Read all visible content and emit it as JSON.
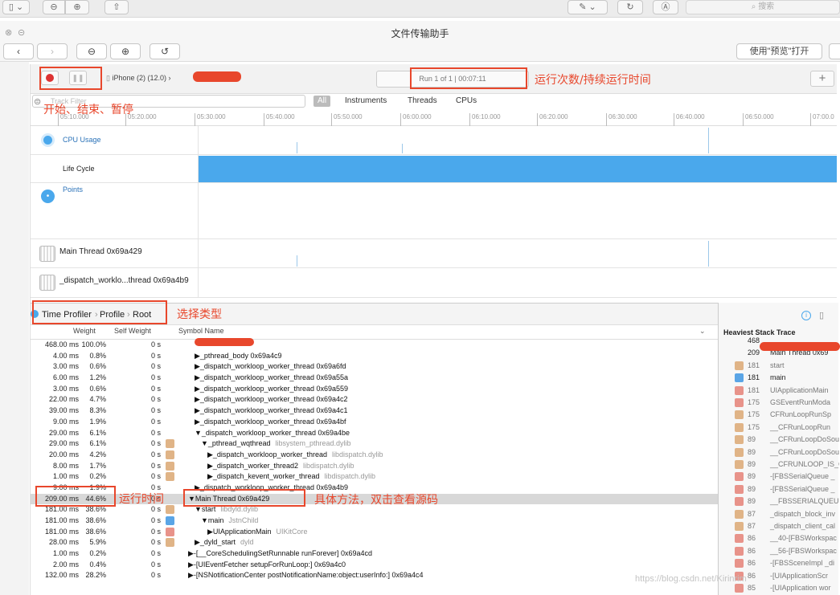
{
  "system_toolbar": {
    "search_placeholder": "搜索"
  },
  "window": {
    "title": "文件传输助手",
    "open_with_preview": "使用\"预览\"打开"
  },
  "instruments": {
    "device": "iPhone (2) (12.0)",
    "status": "Run 1 of 1  |  00:07:11",
    "filter_placeholder": "Track Filter",
    "filters": [
      "All",
      "Instruments",
      "Threads",
      "CPUs"
    ],
    "timeline_ticks": [
      "05:10.000",
      "05:20.000",
      "05:30.000",
      "05:40.000",
      "05:50.000",
      "06:00.000",
      "06:10.000",
      "06:20.000",
      "06:30.000",
      "06:40.000",
      "06:50.000",
      "07:00.0"
    ],
    "tracks": [
      {
        "name": "CPU Usage",
        "icon": "cpu-usage-icon"
      },
      {
        "name": "Life Cycle",
        "icon": ""
      },
      {
        "name": "Points",
        "icon": "points-icon"
      },
      {
        "name": "Main Thread  0x69a429",
        "icon": "thread-icon"
      },
      {
        "name": "_dispatch_worklo...thread  0x69a4b9",
        "icon": "thread-icon"
      }
    ],
    "breadcrumb": [
      "Time Profiler",
      "Profile",
      "Root"
    ],
    "columns": {
      "weight": "Weight",
      "self_weight": "Self Weight",
      "symbol": "Symbol Name"
    },
    "rows": [
      {
        "w": "468.00 ms",
        "p": "100.0%",
        "s": "0 s",
        "sym": "",
        "lib": "",
        "indent": 0,
        "icon": ""
      },
      {
        "w": "4.00 ms",
        "p": "0.8%",
        "s": "0 s",
        "sym": "▶_pthread_body  0x69a4c9",
        "lib": "",
        "indent": 1,
        "icon": ""
      },
      {
        "w": "3.00 ms",
        "p": "0.6%",
        "s": "0 s",
        "sym": "▶_dispatch_workloop_worker_thread  0x69a6fd",
        "lib": "",
        "indent": 1,
        "icon": ""
      },
      {
        "w": "6.00 ms",
        "p": "1.2%",
        "s": "0 s",
        "sym": "▶_dispatch_workloop_worker_thread  0x69a55a",
        "lib": "",
        "indent": 1,
        "icon": ""
      },
      {
        "w": "3.00 ms",
        "p": "0.6%",
        "s": "0 s",
        "sym": "▶_dispatch_workloop_worker_thread  0x69a559",
        "lib": "",
        "indent": 1,
        "icon": ""
      },
      {
        "w": "22.00 ms",
        "p": "4.7%",
        "s": "0 s",
        "sym": "▶_dispatch_workloop_worker_thread  0x69a4c2",
        "lib": "",
        "indent": 1,
        "icon": ""
      },
      {
        "w": "39.00 ms",
        "p": "8.3%",
        "s": "0 s",
        "sym": "▶_dispatch_workloop_worker_thread  0x69a4c1",
        "lib": "",
        "indent": 1,
        "icon": ""
      },
      {
        "w": "9.00 ms",
        "p": "1.9%",
        "s": "0 s",
        "sym": "▶_dispatch_workloop_worker_thread  0x69a4bf",
        "lib": "",
        "indent": 1,
        "icon": ""
      },
      {
        "w": "29.00 ms",
        "p": "6.1%",
        "s": "0 s",
        "sym": "▼_dispatch_workloop_worker_thread  0x69a4be",
        "lib": "",
        "indent": 1,
        "icon": ""
      },
      {
        "w": "29.00 ms",
        "p": "6.1%",
        "s": "0 s",
        "sym": "▼_pthread_wqthread",
        "lib": "libsystem_pthread.dylib",
        "indent": 2,
        "icon": "lib"
      },
      {
        "w": "20.00 ms",
        "p": "4.2%",
        "s": "0 s",
        "sym": "▶_dispatch_workloop_worker_thread",
        "lib": "libdispatch.dylib",
        "indent": 3,
        "icon": "lib"
      },
      {
        "w": "8.00 ms",
        "p": "1.7%",
        "s": "0 s",
        "sym": "▶_dispatch_worker_thread2",
        "lib": "libdispatch.dylib",
        "indent": 3,
        "icon": "lib"
      },
      {
        "w": "1.00 ms",
        "p": "0.2%",
        "s": "0 s",
        "sym": "▶_dispatch_kevent_worker_thread",
        "lib": "libdispatch.dylib",
        "indent": 3,
        "icon": "lib"
      },
      {
        "w": "9.00 ms",
        "p": "1.9%",
        "s": "0 s",
        "sym": "▶_dispatch_workloop_worker_thread  0x69a4b9",
        "lib": "",
        "indent": 1,
        "icon": ""
      },
      {
        "w": "209.00 ms",
        "p": "44.6%",
        "s": "0 s",
        "sym": "▼Main Thread  0x69a429",
        "lib": "",
        "indent": 0,
        "icon": "",
        "hl": true
      },
      {
        "w": "181.00 ms",
        "p": "38.6%",
        "s": "0 s",
        "sym": "▼start",
        "lib": "libdyld.dylib",
        "indent": 1,
        "icon": "lib"
      },
      {
        "w": "181.00 ms",
        "p": "38.6%",
        "s": "0 s",
        "sym": "▼main",
        "lib": "JstnChild",
        "indent": 2,
        "icon": "user"
      },
      {
        "w": "181.00 ms",
        "p": "38.6%",
        "s": "0 s",
        "sym": "▶UIApplicationMain",
        "lib": "UIKitCore",
        "indent": 3,
        "icon": "sys"
      },
      {
        "w": "28.00 ms",
        "p": "5.9%",
        "s": "0 s",
        "sym": "▶_dyld_start",
        "lib": "dyld",
        "indent": 1,
        "icon": "lib"
      },
      {
        "w": "1.00 ms",
        "p": "0.2%",
        "s": "0 s",
        "sym": "▶-[__CoreSchedulingSetRunnable runForever]  0x69a4cd",
        "lib": "",
        "indent": 0,
        "icon": ""
      },
      {
        "w": "2.00 ms",
        "p": "0.4%",
        "s": "0 s",
        "sym": "▶-[UIEventFetcher setupForRunLoop:]  0x69a4c0",
        "lib": "",
        "indent": 0,
        "icon": ""
      },
      {
        "w": "132.00 ms",
        "p": "28.2%",
        "s": "0 s",
        "sym": "▶-[NSNotificationCenter postNotificationName:object:userInfo:]  0x69a4c4",
        "lib": "",
        "indent": 0,
        "icon": ""
      }
    ],
    "heaviest": {
      "title": "Heaviest Stack Trace",
      "rows": [
        {
          "n": "468",
          "l": "",
          "icon": "",
          "dark": true
        },
        {
          "n": "209",
          "l": "Main Thread  0x69",
          "icon": "",
          "dark": true
        },
        {
          "n": "181",
          "l": "start",
          "icon": "lib"
        },
        {
          "n": "181",
          "l": "main",
          "icon": "user",
          "dark": true
        },
        {
          "n": "181",
          "l": "UIApplicationMain",
          "icon": "sys"
        },
        {
          "n": "175",
          "l": "GSEventRunModa",
          "icon": "sys"
        },
        {
          "n": "175",
          "l": "CFRunLoopRunSp",
          "icon": "lib"
        },
        {
          "n": "175",
          "l": "__CFRunLoopRun",
          "icon": "lib"
        },
        {
          "n": "89",
          "l": "__CFRunLoopDoSou",
          "icon": "lib"
        },
        {
          "n": "89",
          "l": "__CFRunLoopDoSou",
          "icon": "lib"
        },
        {
          "n": "89",
          "l": "__CFRUNLOOP_IS_C",
          "icon": "lib"
        },
        {
          "n": "89",
          "l": "-[FBSSerialQueue _",
          "icon": "sys"
        },
        {
          "n": "89",
          "l": "-[FBSSerialQueue _",
          "icon": "sys"
        },
        {
          "n": "89",
          "l": "__FBSSERIALQUEUI",
          "icon": "sys"
        },
        {
          "n": "87",
          "l": "_dispatch_block_inv",
          "icon": "lib"
        },
        {
          "n": "87",
          "l": "_dispatch_client_cal",
          "icon": "lib"
        },
        {
          "n": "86",
          "l": "__40-[FBSWorkspac",
          "icon": "sys"
        },
        {
          "n": "86",
          "l": "__56-[FBSWorkspac",
          "icon": "sys"
        },
        {
          "n": "86",
          "l": "-[FBSSceneImpl _di",
          "icon": "sys"
        },
        {
          "n": "86",
          "l": "-[UIApplicationScr",
          "icon": "sys"
        },
        {
          "n": "85",
          "l": "-[UIApplication wor",
          "icon": "sys"
        }
      ]
    }
  },
  "annotations": {
    "run_stats": "运行次数/持续运行时间",
    "start_stop": "开始、结束、暂停",
    "select_type": "选择类型",
    "run_time": "运行时间",
    "method": "具体方法，双击查看源码"
  },
  "watermark": "https://blog.csdn.net/Kirinrim",
  "colors": {
    "accent": "#4aa8ec",
    "annotation": "#e8472c",
    "lib_icon": "#e0b487",
    "sys_icon": "#e8938a",
    "user_icon": "#5aa5e6"
  }
}
